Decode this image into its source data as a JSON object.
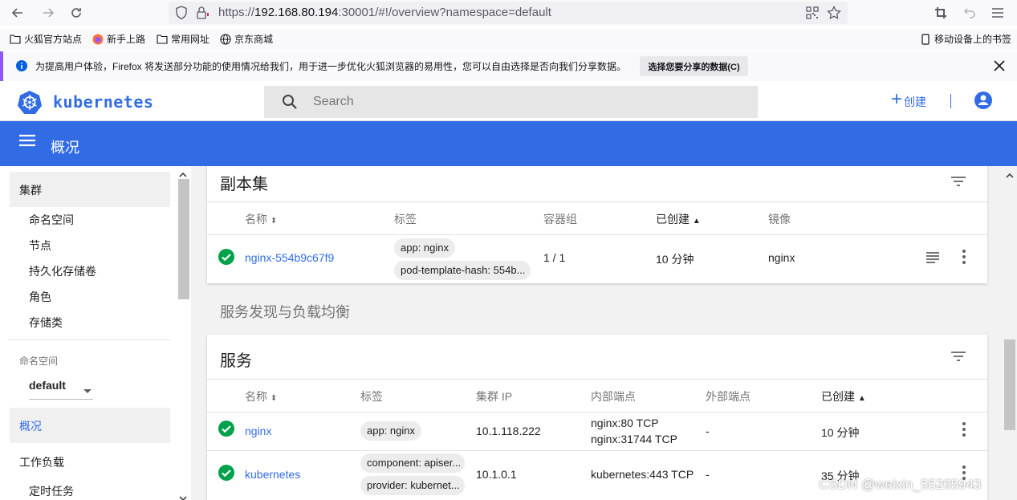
{
  "browser": {
    "url_prefix": "https://",
    "url_host": "192.168.80.194",
    "url_rest": ":30001/#!/overview?namespace=default"
  },
  "bookmarks": [
    {
      "label": "火狐官方站点",
      "icon": "folder-icon"
    },
    {
      "label": "新手上路",
      "icon": "firefox-icon"
    },
    {
      "label": "常用网址",
      "icon": "folder-icon"
    },
    {
      "label": "京东商城",
      "icon": "globe-icon"
    }
  ],
  "mobile_bookmarks": "移动设备上的书签",
  "notice": {
    "text": "为提高用户体验，Firefox 将发送部分功能的使用情况给我们，用于进一步优化火狐浏览器的易用性，您可以自由选择是否向我们分享数据。",
    "button": "选择您要分享的数据(C)"
  },
  "header": {
    "logo": "kubernetes",
    "search_placeholder": "Search",
    "create_label": "创建"
  },
  "titlebar": {
    "title": "概况"
  },
  "sidebar": {
    "cluster": "集群",
    "cluster_items": [
      "命名空间",
      "节点",
      "持久化存储卷",
      "角色",
      "存储类"
    ],
    "namespace_label": "命名空间",
    "namespace_value": "default",
    "overview": "概况",
    "workloads": "工作负载",
    "cronjobs": "定时任务"
  },
  "replicasets": {
    "title": "副本集",
    "columns": [
      "名称",
      "标签",
      "容器组",
      "已创建",
      "镜像"
    ],
    "rows": [
      {
        "name": "nginx-554b9c67f9",
        "labels": [
          "app: nginx",
          "pod-template-hash: 554b..."
        ],
        "pods": "1 / 1",
        "created": "10 分钟",
        "image": "nginx"
      }
    ]
  },
  "section_discovery": "服务发现与负载均衡",
  "services": {
    "title": "服务",
    "columns": [
      "名称",
      "标签",
      "集群 IP",
      "内部端点",
      "外部端点",
      "已创建"
    ],
    "rows": [
      {
        "name": "nginx",
        "labels": [
          "app: nginx"
        ],
        "cluster_ip": "10.1.118.222",
        "internal": [
          "nginx:80 TCP",
          "nginx:31744 TCP"
        ],
        "external": "-",
        "created": "10 分钟"
      },
      {
        "name": "kubernetes",
        "labels": [
          "component: apiser...",
          "provider: kubernet..."
        ],
        "cluster_ip": "10.1.0.1",
        "internal": [
          "kubernetes:443 TCP"
        ],
        "external": "-",
        "created": "35 分钟"
      }
    ]
  },
  "watermark": "CSDN @weixin_55265943",
  "colors": {
    "brand": "#326ce5",
    "success": "#00a14b"
  }
}
